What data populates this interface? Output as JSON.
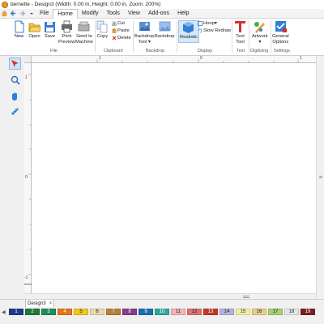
{
  "titlebar": {
    "title": "bernette - Design3 (Width: 0.00 in, Height: 0.00 in, Zoom: 200%)"
  },
  "menu": {
    "items": [
      "File",
      "Home",
      "Modify",
      "Tools",
      "View",
      "Add-ons",
      "Help"
    ],
    "active": "Home"
  },
  "ribbon": {
    "new": "New",
    "open": "Open",
    "save": "Save",
    "print_preview_1": "Print",
    "print_preview_2": "Preview",
    "send_1": "Send to",
    "send_2": "Machine",
    "copy": "Copy",
    "cut": "Cut",
    "paste": "Paste",
    "delete": "Delete",
    "backdrop_tool_1": "Backdrop",
    "backdrop_tool_2": "Tool",
    "backdrop": "Backdrop",
    "realistic": "Realistic",
    "hoop": "Hoop",
    "slow_redraw": "Slow Redraw",
    "text_tool_1": "Text",
    "text_tool_2": "Tool",
    "artwork": "Artwork",
    "general_options_1": "General",
    "general_options_2": "Options",
    "groups": {
      "file": "File",
      "clipboard": "Clipboard",
      "backdrop": "Backdrop",
      "display": "Display",
      "text": "Text",
      "digitizing": "Digitizing",
      "settings": "Settings"
    }
  },
  "rulers": {
    "top": [
      "1",
      "0",
      "1"
    ],
    "left": [
      "1",
      "0",
      "-1"
    ],
    "unit": "inches"
  },
  "doc_tab": {
    "label": "Design3",
    "close": "×"
  },
  "palette": {
    "colors": [
      {
        "n": "1",
        "c": "#1e3c8c",
        "t": "#ffffff"
      },
      {
        "n": "2",
        "c": "#1f7a3a",
        "t": "#ffffff"
      },
      {
        "n": "3",
        "c": "#1a8f5a",
        "t": "#ffffff"
      },
      {
        "n": "4",
        "c": "#e8741a",
        "t": "#ffffff"
      },
      {
        "n": "5",
        "c": "#f2c81e",
        "t": "#222222"
      },
      {
        "n": "6",
        "c": "#e9d9a8",
        "t": "#222222"
      },
      {
        "n": "7",
        "c": "#b5813a",
        "t": "#ffffff"
      },
      {
        "n": "8",
        "c": "#8a3a8a",
        "t": "#ffffff"
      },
      {
        "n": "9",
        "c": "#1a6fb0",
        "t": "#ffffff"
      },
      {
        "n": "10",
        "c": "#2fa89a",
        "t": "#ffffff"
      },
      {
        "n": "11",
        "c": "#f2b5b5",
        "t": "#222222"
      },
      {
        "n": "12",
        "c": "#e07070",
        "t": "#222222"
      },
      {
        "n": "13",
        "c": "#c0392b",
        "t": "#ffffff"
      },
      {
        "n": "14",
        "c": "#b8b0e0",
        "t": "#222222"
      },
      {
        "n": "15",
        "c": "#f3efa0",
        "t": "#222222"
      },
      {
        "n": "16",
        "c": "#e8d080",
        "t": "#222222"
      },
      {
        "n": "17",
        "c": "#a8d070",
        "t": "#222222"
      },
      {
        "n": "18",
        "c": "#e6e6e6",
        "t": "#222222"
      },
      {
        "n": "19",
        "c": "#7a2020",
        "t": "#ffffff"
      }
    ]
  },
  "icons": {
    "home": "⌂",
    "back": "◀",
    "forward": "▶",
    "pointer": "➤",
    "zoom": "🔍",
    "hand": "✋",
    "measure": "📏"
  }
}
